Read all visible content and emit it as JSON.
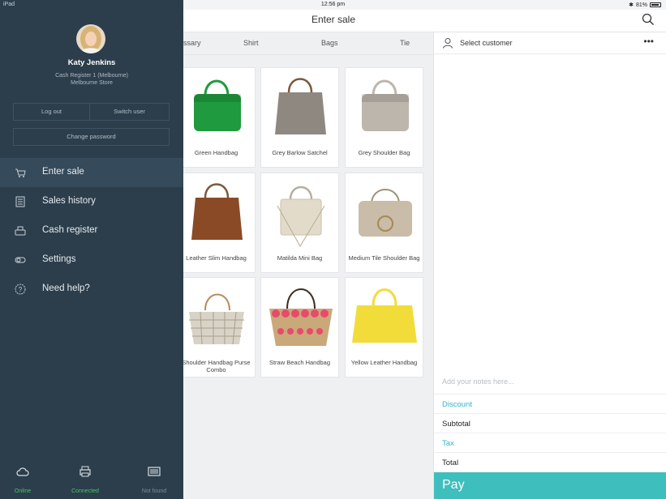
{
  "status_bar": {
    "device": "iPad",
    "time": "12:56 pm",
    "battery": "81%"
  },
  "header": {
    "title": "Enter sale"
  },
  "tabs": [
    "ssary",
    "Shirt",
    "Bags",
    "Tie"
  ],
  "products": [
    {
      "name": "Green Handbag",
      "color": "#1f9a3e"
    },
    {
      "name": "Grey Barlow Satchel",
      "color": "#8f8880"
    },
    {
      "name": "Grey Shoulder Bag",
      "color": "#bdb6ad"
    },
    {
      "name": "Leather Slim Handbag",
      "color": "#8a4a25"
    },
    {
      "name": "Matilda Mini Bag",
      "color": "#e3dbca"
    },
    {
      "name": "Medium Tile Shoulder Bag",
      "color": "#c9bca8"
    },
    {
      "name": "Shoulder Handbag Purse Combo",
      "color": "#d8d3c6"
    },
    {
      "name": "Straw Beach Handbag",
      "color": "#c9a87a"
    },
    {
      "name": "Yellow Leather Handbag",
      "color": "#f2dc3a"
    }
  ],
  "cart": {
    "customer_label": "Select customer",
    "more": "•••",
    "notes_placeholder": "Add your notes here...",
    "discount": "Discount",
    "subtotal": "Subtotal",
    "tax": "Tax",
    "total": "Total",
    "pay": "Pay"
  },
  "sidebar": {
    "user_name": "Katy Jenkins",
    "register": "Cash Register 1 (Melbourne)",
    "store": "Melbourne Store",
    "log_out": "Log out",
    "switch_user": "Switch user",
    "change_password": "Change password",
    "menu": [
      {
        "label": "Enter sale",
        "icon": "cart-icon"
      },
      {
        "label": "Sales history",
        "icon": "receipt-icon"
      },
      {
        "label": "Cash register",
        "icon": "cash-register-icon"
      },
      {
        "label": "Settings",
        "icon": "toggle-icon"
      },
      {
        "label": "Need help?",
        "icon": "help-icon"
      }
    ],
    "footer": [
      {
        "label": "Online",
        "icon": "cloud-icon",
        "color": "#4cc26b"
      },
      {
        "label": "Connected",
        "icon": "printer-icon",
        "color": "#4cc26b"
      },
      {
        "label": "Not found",
        "icon": "barcode-scanner-icon",
        "color": "#7b8b98"
      }
    ]
  },
  "colors": {
    "accent": "#3ebfbe",
    "sidebar": "#2c3e4c",
    "link": "#2fb5c8"
  }
}
